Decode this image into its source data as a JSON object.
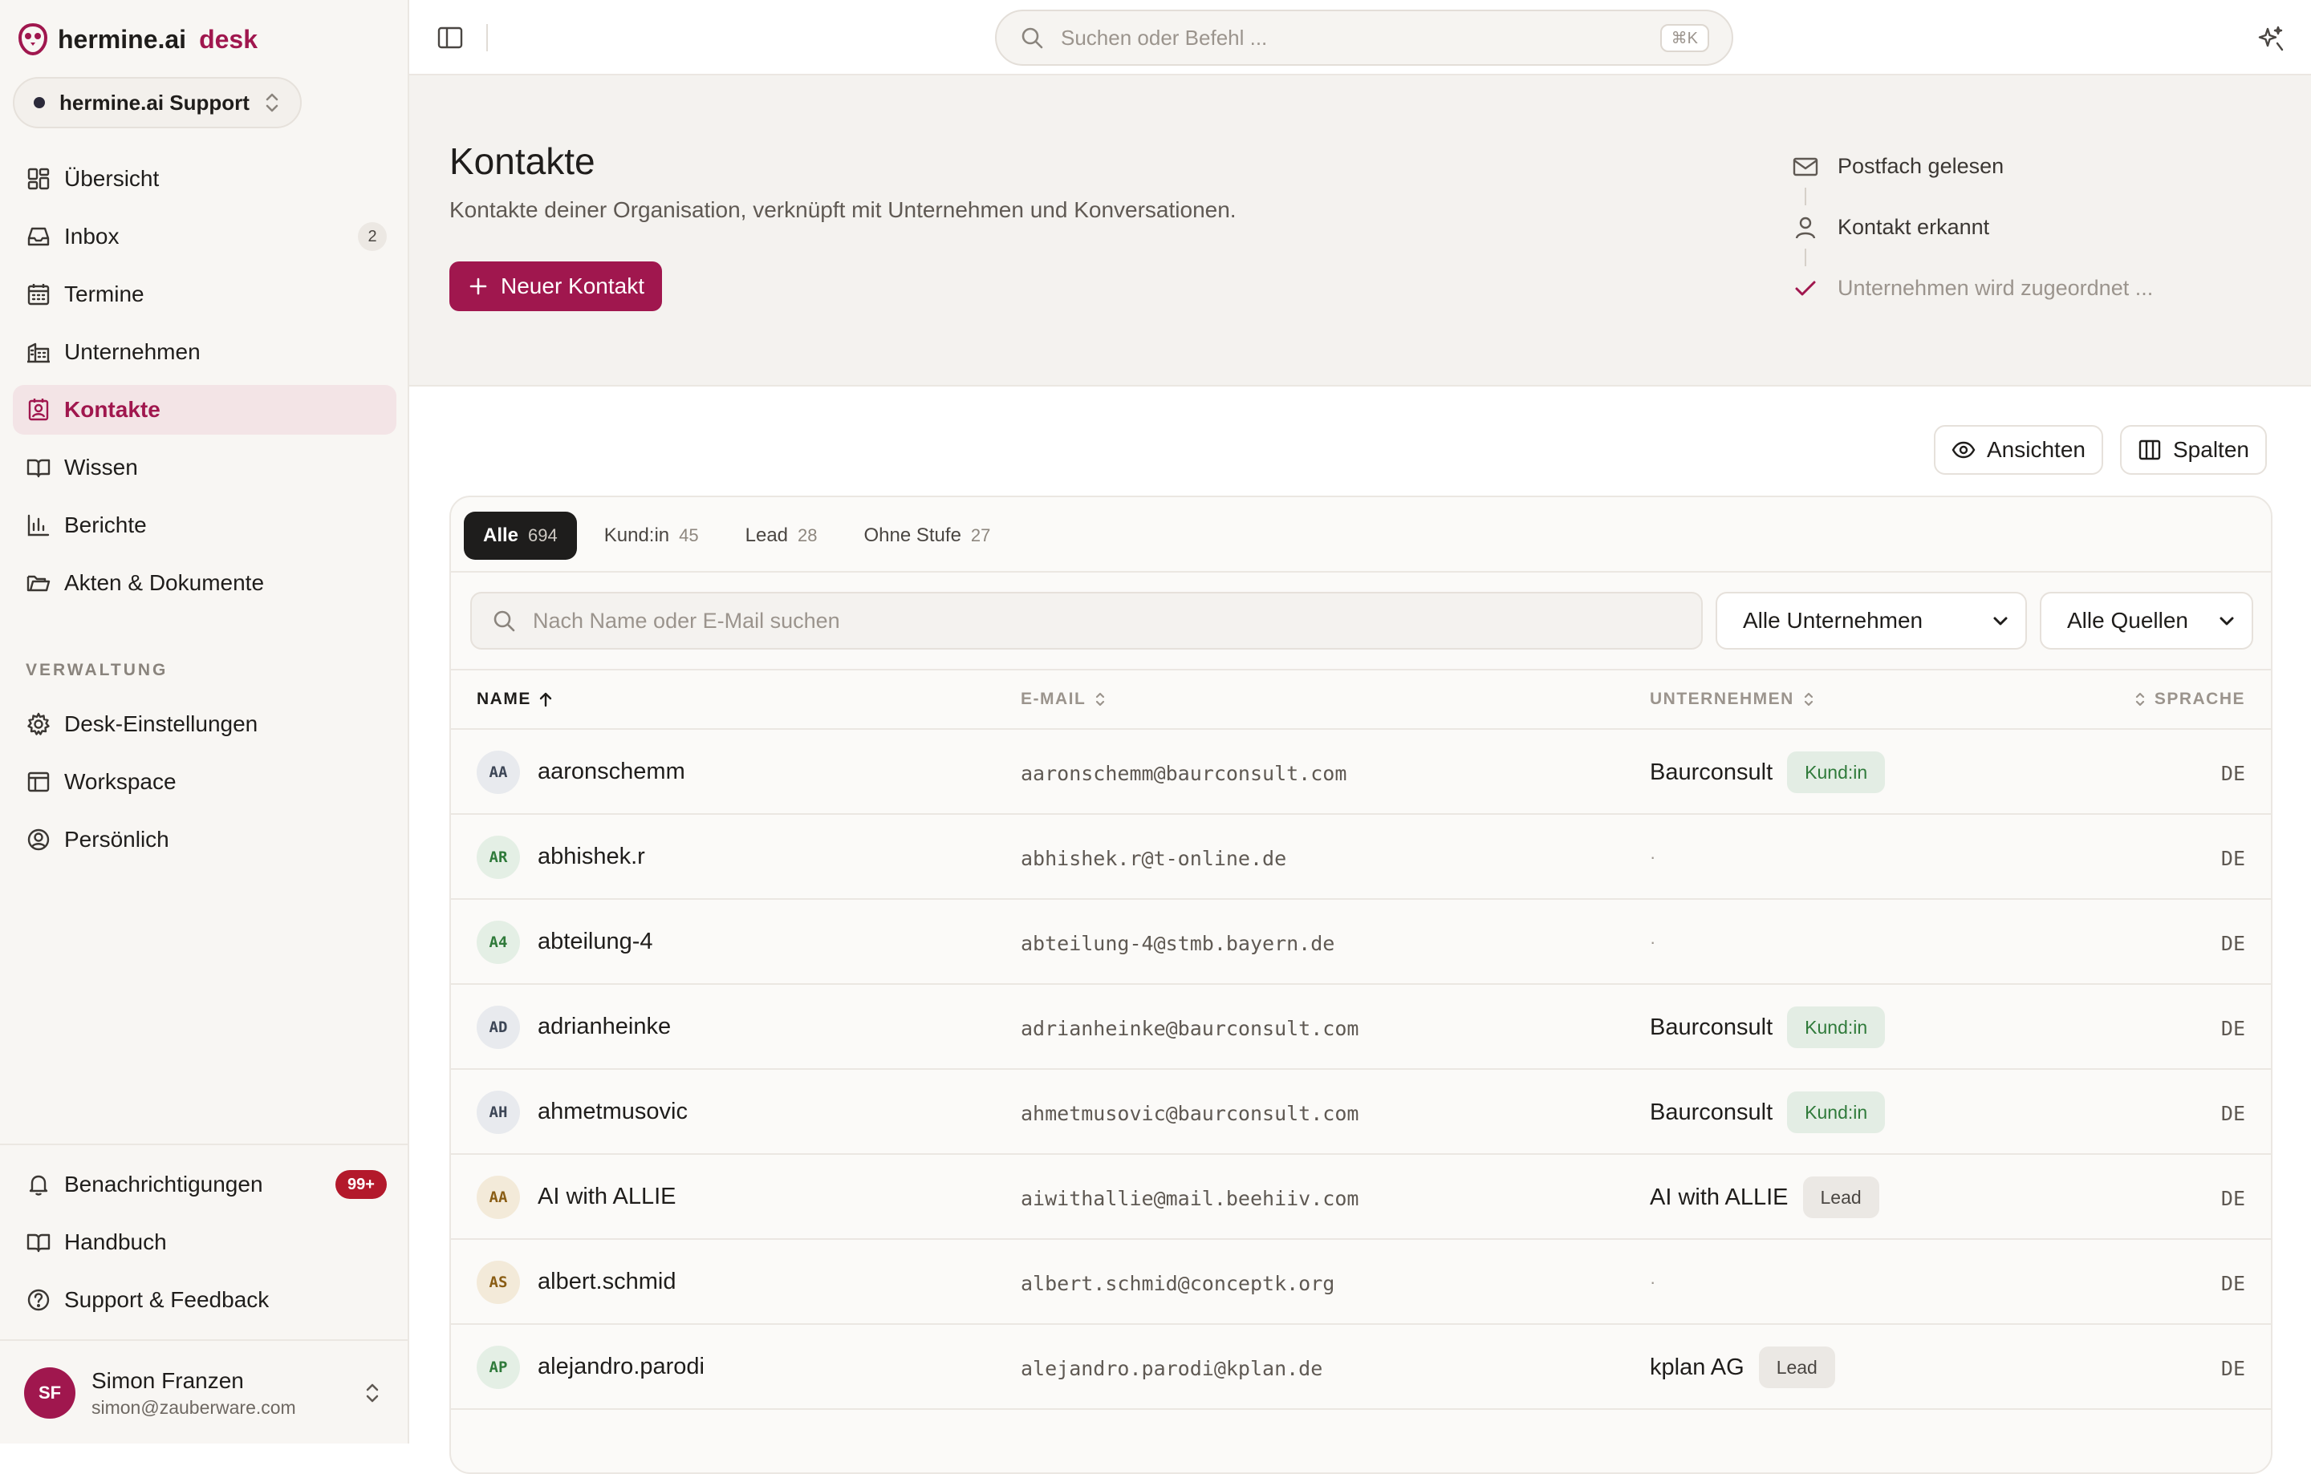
{
  "brand": {
    "name": "hermine.ai",
    "product": "desk",
    "accent": "#a0174e"
  },
  "workspace": {
    "name": "hermine.ai Support"
  },
  "nav": {
    "main": [
      {
        "label": "Übersicht",
        "icon": "dashboard-icon"
      },
      {
        "label": "Inbox",
        "icon": "inbox-icon",
        "badge": "2"
      },
      {
        "label": "Termine",
        "icon": "calendar-icon"
      },
      {
        "label": "Unternehmen",
        "icon": "building-icon"
      },
      {
        "label": "Kontakte",
        "icon": "contact-icon",
        "active": true
      },
      {
        "label": "Wissen",
        "icon": "book-icon"
      },
      {
        "label": "Berichte",
        "icon": "bar-chart-icon"
      },
      {
        "label": "Akten & Dokumente",
        "icon": "folder-icon"
      }
    ],
    "section_label": "VERWALTUNG",
    "admin": [
      {
        "label": "Desk-Einstellungen",
        "icon": "gear-icon"
      },
      {
        "label": "Workspace",
        "icon": "layout-icon"
      },
      {
        "label": "Persönlich",
        "icon": "user-circle-icon"
      }
    ],
    "bottom": [
      {
        "label": "Benachrichtigungen",
        "icon": "bell-icon",
        "badge": "99+"
      },
      {
        "label": "Handbuch",
        "icon": "book-icon"
      },
      {
        "label": "Support & Feedback",
        "icon": "help-icon"
      }
    ]
  },
  "user": {
    "initials": "SF",
    "name": "Simon Franzen",
    "email": "simon@zauberware.com"
  },
  "topbar": {
    "search_placeholder": "Suchen oder Befehl ...",
    "shortcut": "⌘K"
  },
  "header": {
    "title": "Kontakte",
    "subtitle": "Kontakte deiner Organisation, verknüpft mit Unternehmen und Konversationen.",
    "new_button": "Neuer Kontakt",
    "timeline": [
      {
        "label": "Postfach gelesen",
        "icon": "mail-icon",
        "state": "done"
      },
      {
        "label": "Kontakt erkannt",
        "icon": "person-icon",
        "state": "done"
      },
      {
        "label": "Unternehmen wird zugeordnet ...",
        "icon": "check-icon",
        "state": "pending"
      }
    ]
  },
  "toolbar": {
    "views_label": "Ansichten",
    "columns_label": "Spalten"
  },
  "tabs": [
    {
      "label": "Alle",
      "count": "694",
      "active": true
    },
    {
      "label": "Kund:in",
      "count": "45"
    },
    {
      "label": "Lead",
      "count": "28"
    },
    {
      "label": "Ohne Stufe",
      "count": "27"
    }
  ],
  "filters": {
    "search_placeholder": "Nach Name oder E-Mail suchen",
    "company_select": "Alle Unternehmen",
    "source_select": "Alle Quellen"
  },
  "table": {
    "columns": {
      "name": "NAME",
      "email": "E-MAIL",
      "company": "UNTERNEHMEN",
      "language": "SPRACHE"
    },
    "rows": [
      {
        "initials": "AA",
        "name": "aaronschemm",
        "email": "aaronschemm@baurconsult.com",
        "company": "Baurconsult",
        "stage": "Kund:in",
        "language": "DE",
        "tone": "slate"
      },
      {
        "initials": "AR",
        "name": "abhishek.r",
        "email": "abhishek.r@t-online.de",
        "company": "",
        "stage": "",
        "language": "DE",
        "tone": "green"
      },
      {
        "initials": "A4",
        "name": "abteilung-4",
        "email": "abteilung-4@stmb.bayern.de",
        "company": "",
        "stage": "",
        "language": "DE",
        "tone": "green"
      },
      {
        "initials": "AD",
        "name": "adrianheinke",
        "email": "adrianheinke@baurconsult.com",
        "company": "Baurconsult",
        "stage": "Kund:in",
        "language": "DE",
        "tone": "slate"
      },
      {
        "initials": "AH",
        "name": "ahmetmusovic",
        "email": "ahmetmusovic@baurconsult.com",
        "company": "Baurconsult",
        "stage": "Kund:in",
        "language": "DE",
        "tone": "slate"
      },
      {
        "initials": "AA",
        "name": "AI with ALLIE",
        "email": "aiwithallie@mail.beehiiv.com",
        "company": "AI with ALLIE",
        "stage": "Lead",
        "language": "DE",
        "tone": "amber"
      },
      {
        "initials": "AS",
        "name": "albert.schmid",
        "email": "albert.schmid@conceptk.org",
        "company": "",
        "stage": "",
        "language": "DE",
        "tone": "amber"
      },
      {
        "initials": "AP",
        "name": "alejandro.parodi",
        "email": "alejandro.parodi@kplan.de",
        "company": "kplan AG",
        "stage": "Lead",
        "language": "DE",
        "tone": "green"
      }
    ]
  }
}
